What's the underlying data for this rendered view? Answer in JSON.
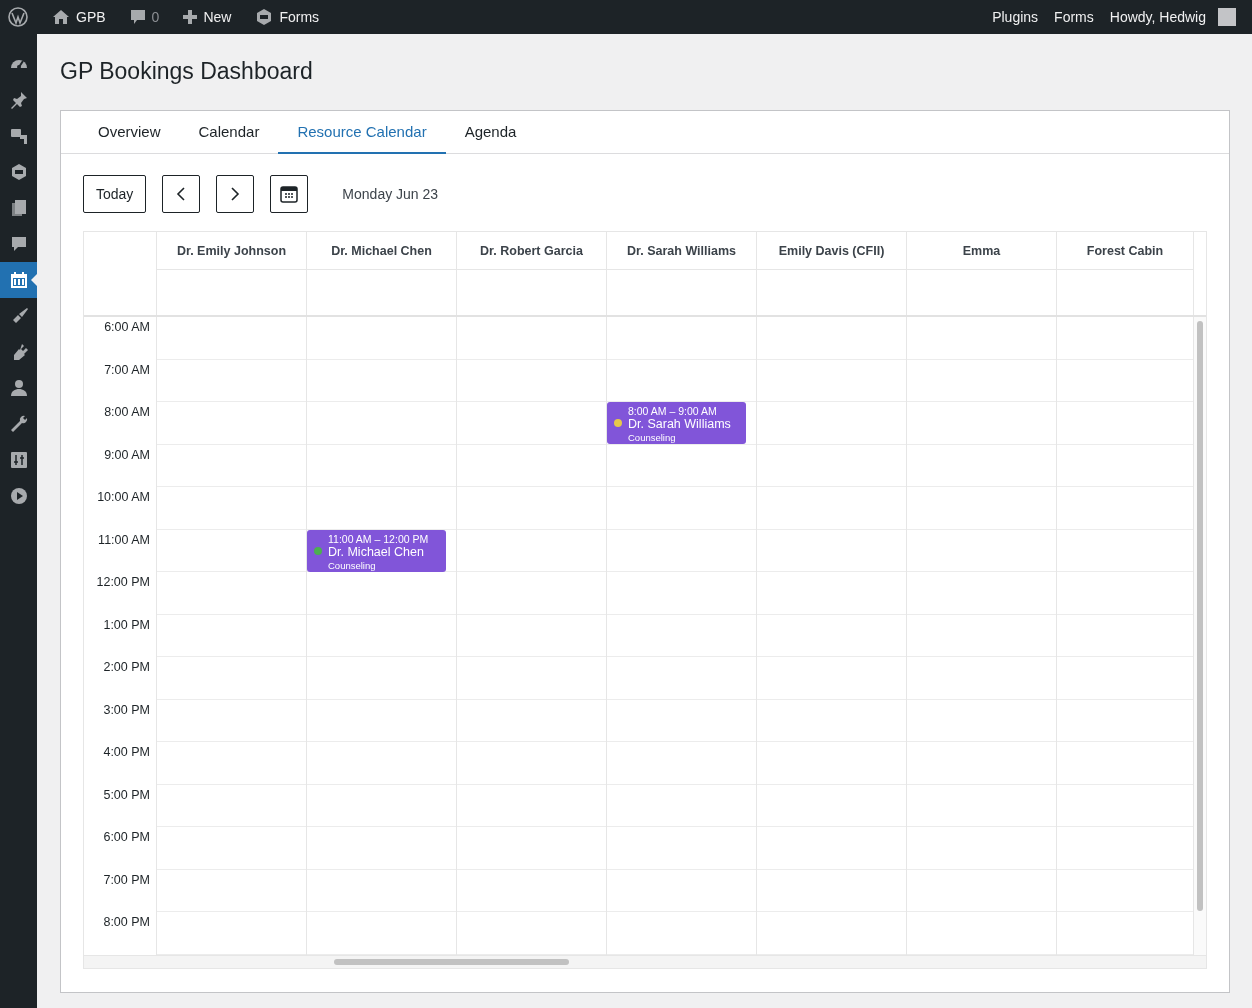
{
  "admin_bar": {
    "site": "GPB",
    "comments": "0",
    "new": "New",
    "forms": "Forms",
    "right_links": [
      "Plugins",
      "Forms"
    ],
    "greeting": "Howdy, Hedwig"
  },
  "sidebar": {
    "items": [
      {
        "selected": false
      },
      {
        "selected": false
      },
      {
        "selected": false
      },
      {
        "selected": false
      },
      {
        "selected": false
      },
      {
        "selected": false
      },
      {
        "selected": true
      },
      {
        "selected": false
      },
      {
        "selected": false
      },
      {
        "selected": false
      },
      {
        "selected": false
      },
      {
        "selected": false
      },
      {
        "selected": false
      }
    ]
  },
  "page_title": "GP Bookings Dashboard",
  "tabs": [
    {
      "label": "Overview",
      "selected": false
    },
    {
      "label": "Calendar",
      "selected": false
    },
    {
      "label": "Resource Calendar",
      "selected": true
    },
    {
      "label": "Agenda",
      "selected": false
    }
  ],
  "toolbar": {
    "today": "Today",
    "date": "Monday Jun 23"
  },
  "hours": [
    "6:00 AM",
    "7:00 AM",
    "8:00 AM",
    "9:00 AM",
    "10:00 AM",
    "11:00 AM",
    "12:00 PM",
    "1:00 PM",
    "2:00 PM",
    "3:00 PM",
    "4:00 PM",
    "5:00 PM",
    "6:00 PM",
    "7:00 PM",
    "8:00 PM"
  ],
  "resources": [
    {
      "name": "Dr. Emily Johnson"
    },
    {
      "name": "Dr. Michael Chen",
      "events": [
        {
          "start": "11:00 AM",
          "end": "12:00 PM",
          "title": "Dr. Michael Chen",
          "subtitle": "Counseling",
          "color": "#4caf50"
        }
      ]
    },
    {
      "name": "Dr. Robert Garcia"
    },
    {
      "name": "Dr. Sarah Williams",
      "events": [
        {
          "start": "8:00 AM",
          "end": "9:00 AM",
          "title": "Dr. Sarah Williams",
          "subtitle": "Counseling",
          "color": "#e6c84a"
        }
      ]
    },
    {
      "name": "Emily Davis (CFII)"
    },
    {
      "name": "Emma"
    },
    {
      "name": "Forest Cabin"
    }
  ],
  "time_range_separator": "–"
}
